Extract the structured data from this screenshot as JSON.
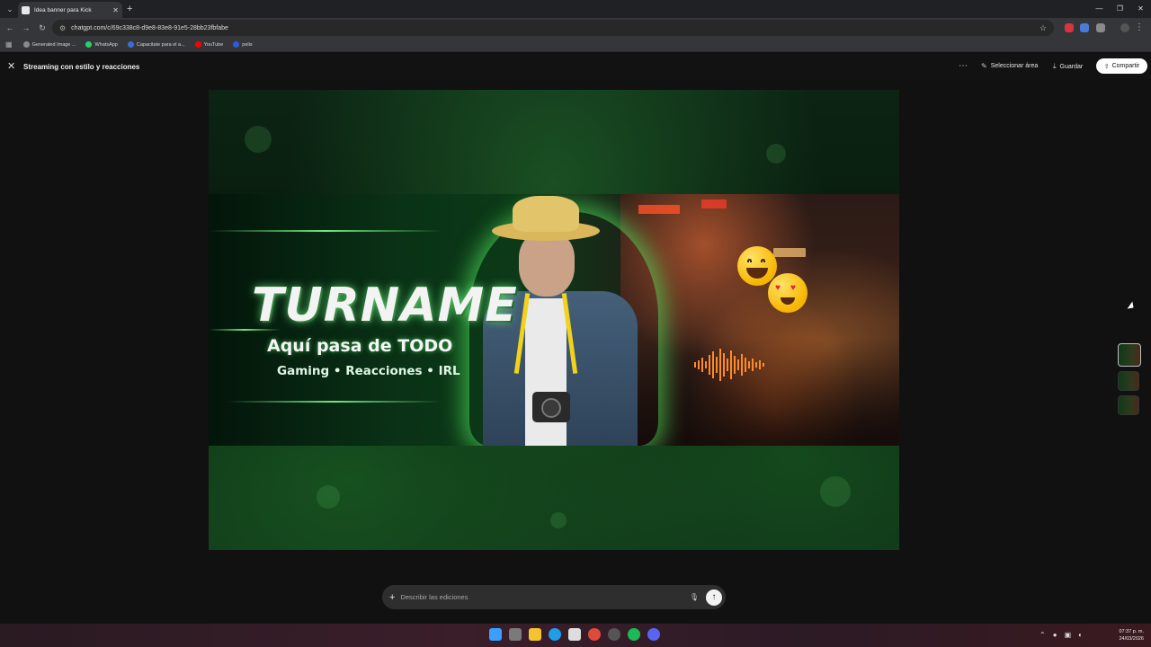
{
  "browser": {
    "tab_title": "Idea banner para Kick",
    "url": "chatgpt.com/c/69c338c8-d9e8-83e8-91e5-28bb23fbfabe",
    "bookmarks": [
      {
        "label": "Generated Image ...",
        "color": "#8a8a8a"
      },
      {
        "label": "WhatsApp",
        "color": "#25d366"
      },
      {
        "label": "Capacitate para el a...",
        "color": "#3a6fd6"
      },
      {
        "label": "YouTube",
        "color": "#ff0000"
      },
      {
        "label": "pelis",
        "color": "#2a5bd8"
      }
    ]
  },
  "app": {
    "conversation_title": "Streaming con estilo y reacciones",
    "select_area_label": "Seleccionar área",
    "save_label": "Guardar",
    "share_label": "Compartir"
  },
  "banner": {
    "title": "TURNAME",
    "subtitle": "Aquí pasa de TODO",
    "tags": "Gaming • Reacciones • IRL"
  },
  "composer": {
    "placeholder": "Describir las ediciones"
  },
  "taskbar": {
    "time": "07:37 p. m.",
    "date": "24/03/2026"
  },
  "colors": {
    "accent_green": "#5cff6e",
    "share_button_bg": "#ffffff",
    "page_bg": "#111111"
  }
}
